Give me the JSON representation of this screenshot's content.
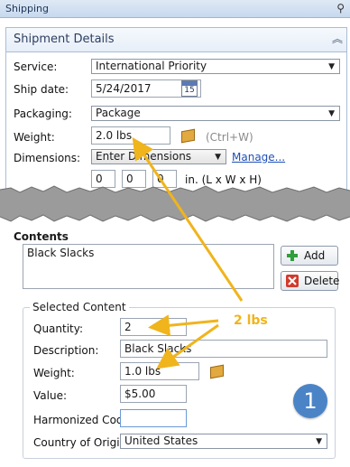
{
  "titlebar": {
    "title": "Shipping",
    "pin_icon": "pin-icon"
  },
  "shipment_details": {
    "title": "Shipment Details",
    "service": {
      "label": "Service:",
      "value": "International Priority"
    },
    "ship_date": {
      "label": "Ship date:",
      "value": "5/24/2017",
      "calendar_day": "15"
    },
    "packaging": {
      "label": "Packaging:",
      "value": "Package"
    },
    "weight": {
      "label": "Weight:",
      "value": "2.0 lbs",
      "hint": "(Ctrl+W)"
    },
    "dimensions": {
      "label": "Dimensions:",
      "value": "Enter Dimensions",
      "manage_link": "Manage...",
      "l": "0",
      "w": "0",
      "h": "0",
      "unit": "in. (L x W x H)"
    }
  },
  "contents": {
    "title": "Contents",
    "items": [
      "Black Slacks"
    ],
    "add_label": "Add",
    "delete_label": "Delete"
  },
  "selected_content": {
    "title": "Selected Content",
    "quantity": {
      "label": "Quantity:",
      "value": "2"
    },
    "description": {
      "label": "Description:",
      "value": "Black Slacks"
    },
    "weight": {
      "label": "Weight:",
      "value": "1.0 lbs"
    },
    "value": {
      "label": "Value:",
      "value": "$5.00"
    },
    "harmonized_code": {
      "label": "Harmonized Code:",
      "value": ""
    },
    "country": {
      "label": "Country of Origin:",
      "value": "United States"
    }
  },
  "annotations": {
    "callout": "2 lbs",
    "step_badge": "1"
  },
  "colors": {
    "accent": "#f0b41c",
    "badge": "#4b84c6",
    "link": "#1f4fb7"
  }
}
